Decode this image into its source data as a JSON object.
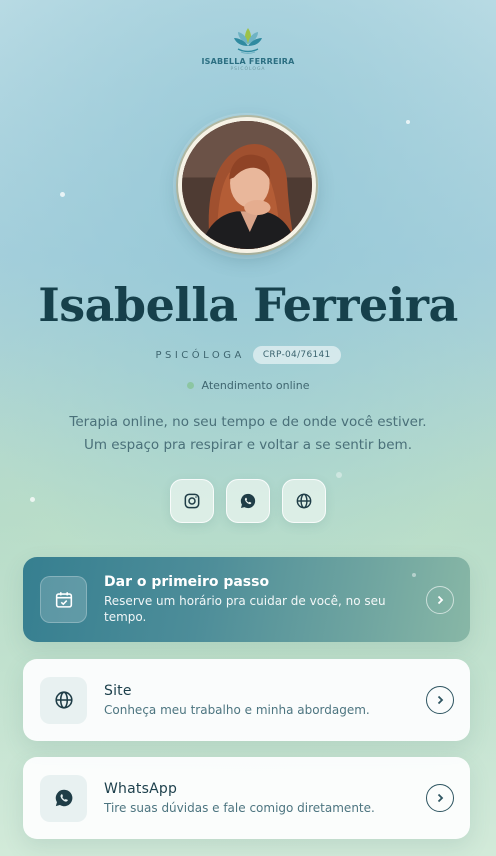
{
  "brand": {
    "name": "ISABELLA FERREIRA",
    "subtitle": "PSICÓLOGA",
    "logo_icon": "leaf-lotus-icon",
    "colors": {
      "primary": "#2c6f82",
      "accent": "#9dc24a"
    }
  },
  "profile": {
    "name": "Isabella Ferreira",
    "role": "PSICÓLOGA",
    "crp": "CRP-04/76141",
    "status": "Atendimento online",
    "bio_line1": "Terapia online, no seu tempo e de onde você estiver.",
    "bio_line2": "Um espaço pra respirar e voltar a se sentir bem."
  },
  "social": [
    {
      "icon": "instagram-icon"
    },
    {
      "icon": "whatsapp-icon"
    },
    {
      "icon": "globe-icon"
    }
  ],
  "links": [
    {
      "icon": "calendar-check-icon",
      "title": "Dar o primeiro passo",
      "description": "Reserve um horário pra cuidar de você, no seu tempo."
    },
    {
      "icon": "globe-icon",
      "title": "Site",
      "description": "Conheça meu trabalho e minha abordagem."
    },
    {
      "icon": "whatsapp-icon",
      "title": "WhatsApp",
      "description": "Tire suas dúvidas e fale comigo diretamente."
    }
  ]
}
